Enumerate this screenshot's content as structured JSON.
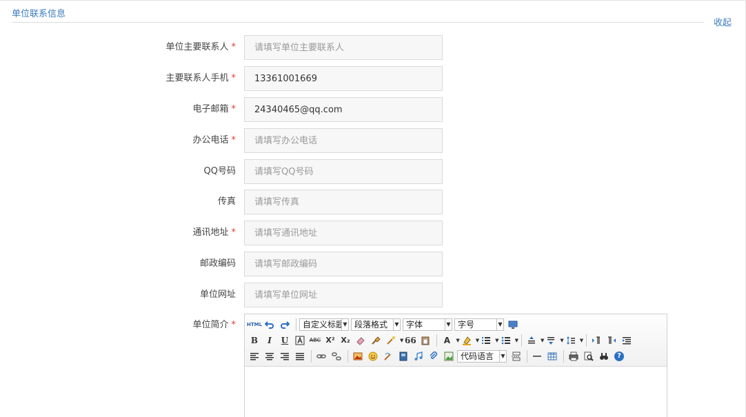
{
  "section": {
    "title": "单位联系信息",
    "collapse_label": "收起"
  },
  "fields": [
    {
      "label": "单位主要联系人",
      "required": true,
      "value": "",
      "placeholder": "请填写单位主要联系人"
    },
    {
      "label": "主要联系人手机",
      "required": true,
      "value": "13361001669",
      "placeholder": ""
    },
    {
      "label": "电子邮箱",
      "required": true,
      "value": "24340465@qq.com",
      "placeholder": ""
    },
    {
      "label": "办公电话",
      "required": true,
      "value": "",
      "placeholder": "请填写办公电话"
    },
    {
      "label": "QQ号码",
      "required": false,
      "value": "",
      "placeholder": "请填写QQ号码"
    },
    {
      "label": "传真",
      "required": false,
      "value": "",
      "placeholder": "请填写传真"
    },
    {
      "label": "通讯地址",
      "required": true,
      "value": "",
      "placeholder": "请填写通讯地址"
    },
    {
      "label": "邮政编码",
      "required": false,
      "value": "",
      "placeholder": "请填写邮政编码"
    },
    {
      "label": "单位网址",
      "required": false,
      "value": "",
      "placeholder": "请填写单位网址"
    }
  ],
  "intro": {
    "label": "单位简介",
    "required_mark": "*"
  },
  "required_mark": "*",
  "editor": {
    "custom_heading": "自定义标题",
    "paragraph_format": "段落格式",
    "font_family": "字体",
    "font_size": "字号",
    "code_language": "代码语言",
    "icons": {
      "html": "HTML",
      "bold": "B",
      "italic": "I",
      "underline": "U",
      "strikethrough": "ABC",
      "superscript": "X²",
      "subscript": "X₂",
      "quote": "66",
      "font_color": "A",
      "help": "?"
    }
  },
  "colors": {
    "link": "#3b7bbf",
    "required": "#e03c31",
    "input_bg": "#f7f7f7"
  }
}
